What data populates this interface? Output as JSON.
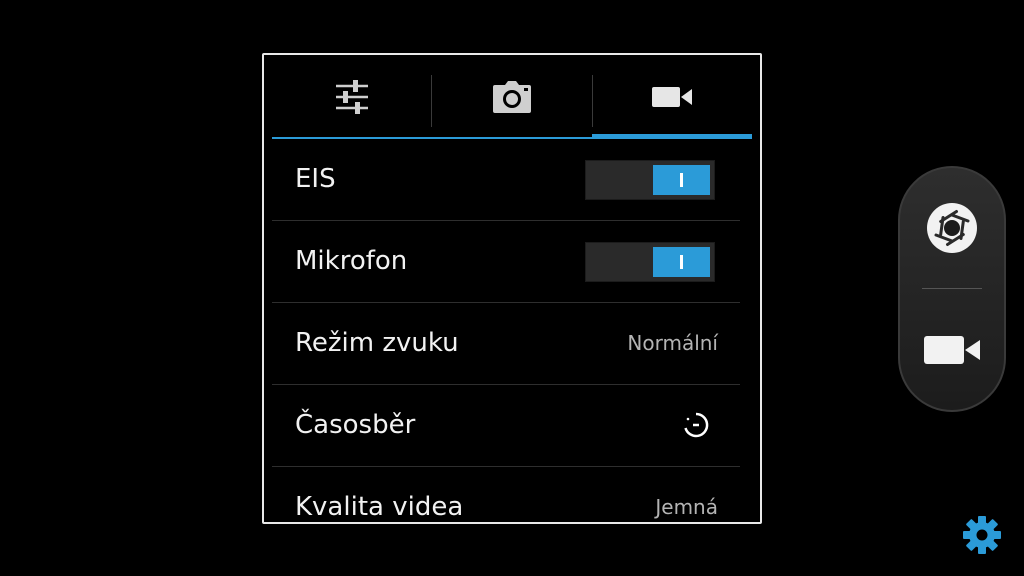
{
  "tabs": [
    {
      "name": "sliders-icon"
    },
    {
      "name": "camera-icon"
    },
    {
      "name": "video-camera-icon",
      "active": true
    }
  ],
  "settings": {
    "eis": {
      "label": "EIS",
      "enabled": true
    },
    "microphone": {
      "label": "Mikrofon",
      "enabled": true
    },
    "sound_mode": {
      "label": "Režim zvuku",
      "value": "Normální"
    },
    "timelapse": {
      "label": "Časosběr",
      "icon": "timer-icon"
    },
    "video_quality": {
      "label": "Kvalita videa",
      "value": "Jemná"
    }
  },
  "controls": {
    "shutter_icon": "aperture-icon",
    "mode_icon": "video-camera-icon",
    "settings_icon": "gear-icon"
  },
  "colors": {
    "accent": "#2b9bd8",
    "background": "#000000"
  }
}
